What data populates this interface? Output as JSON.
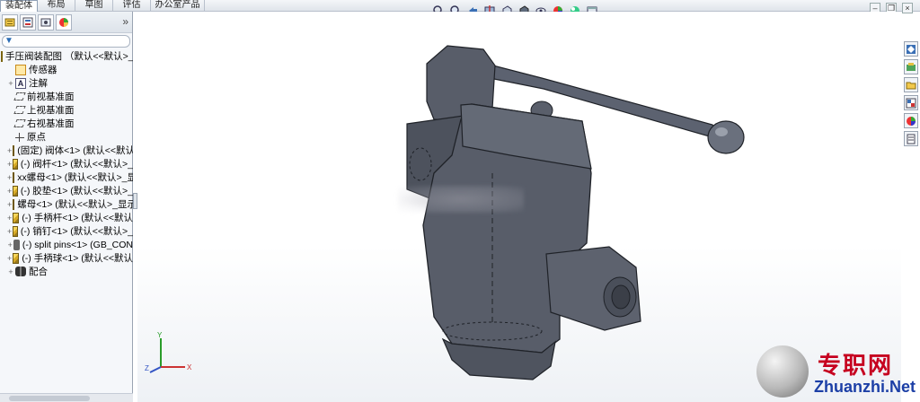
{
  "command_tabs": [
    "装配体",
    "布局",
    "草图",
    "评估",
    "办公室产品"
  ],
  "active_tab": "装配体",
  "view_toolbar_icons": [
    "zoom-to-fit-icon",
    "zoom-area-icon",
    "previous-view-icon",
    "section-view-icon",
    "view-orientation-icon",
    "display-style-icon",
    "hide-show-icon",
    "edit-appearance-icon",
    "apply-scene-icon",
    "view-settings-icon"
  ],
  "window_controls": [
    "minimize",
    "restore",
    "close"
  ],
  "pane_tabs": [
    "feature-manager-icon",
    "property-manager-icon",
    "configuration-manager-icon",
    "display-manager-icon"
  ],
  "pane_more": "»",
  "tree": [
    {
      "expander": "",
      "icon": "asm",
      "text": "手压阀装配图 （默认<<默认>_多"
    },
    {
      "expander": "",
      "icon": "sensor",
      "text": "传感器"
    },
    {
      "expander": "+",
      "icon": "annot",
      "text": "注解"
    },
    {
      "expander": "",
      "icon": "plane",
      "text": "前视基准面"
    },
    {
      "expander": "",
      "icon": "plane",
      "text": "上视基准面"
    },
    {
      "expander": "",
      "icon": "plane",
      "text": "右视基准面"
    },
    {
      "expander": "",
      "icon": "origin",
      "text": "原点"
    },
    {
      "expander": "+",
      "icon": "part",
      "text": "(固定) 阀体<1> (默认<<默认"
    },
    {
      "expander": "+",
      "icon": "part",
      "text": "(-) 阀杆<1> (默认<<默认>_"
    },
    {
      "expander": "+",
      "icon": "part",
      "text": "xx螺母<1> (默认<<默认>_显"
    },
    {
      "expander": "+",
      "icon": "part",
      "text": "(-) 胶垫<1> (默认<<默认>_"
    },
    {
      "expander": "+",
      "icon": "part",
      "text": "螺母<1> (默认<<默认>_显示"
    },
    {
      "expander": "+",
      "icon": "part",
      "text": "(-) 手柄杆<1> (默认<<默认"
    },
    {
      "expander": "+",
      "icon": "part",
      "text": "(-) 销钉<1> (默认<<默认>_"
    },
    {
      "expander": "+",
      "icon": "pin",
      "text": "(-) split pins<1> (GB_CON"
    },
    {
      "expander": "+",
      "icon": "part",
      "text": "(-) 手柄球<1> (默认<<默认"
    },
    {
      "expander": "+",
      "icon": "mate",
      "text": "配合"
    }
  ],
  "task_pane_icons": [
    "solidworks-resources-icon",
    "design-library-icon",
    "file-explorer-icon",
    "view-palette-icon",
    "appearances-icon",
    "custom-properties-icon"
  ],
  "triad_labels": {
    "x": "X",
    "y": "Y",
    "z": "Z"
  },
  "watermark": {
    "cn": "专职网",
    "en": "Zhuanzhi.Net"
  },
  "colors": {
    "model_fill": "#585d69",
    "model_edge": "#1f2228",
    "accent_red": "#c6001f",
    "accent_blue": "#1c3fa6"
  }
}
